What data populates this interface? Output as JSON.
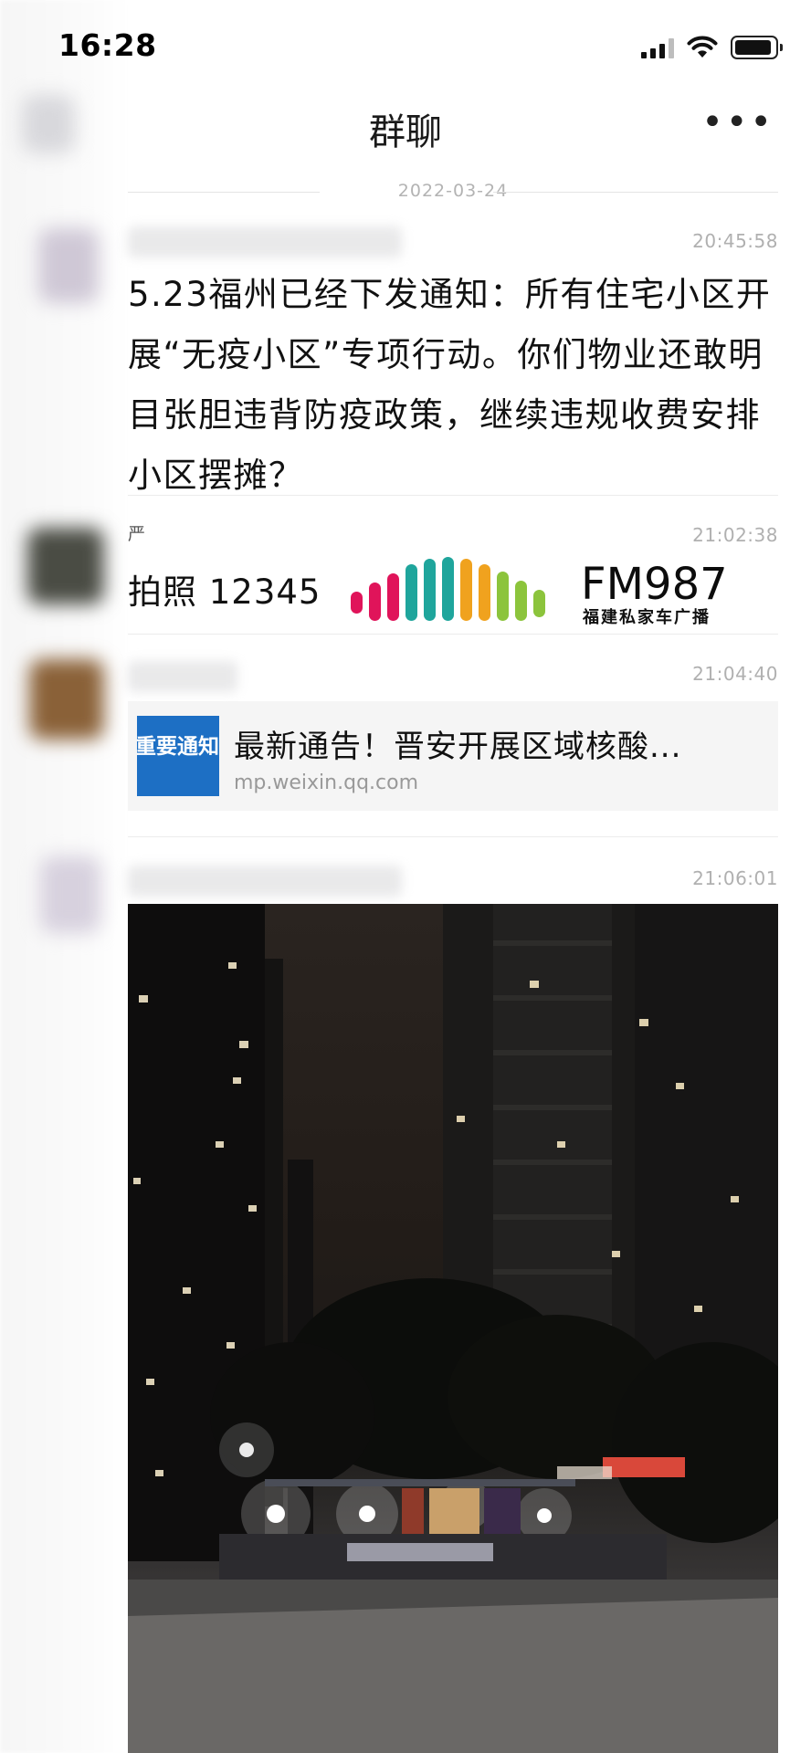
{
  "status_bar": {
    "time": "16:28"
  },
  "header": {
    "title": "群聊",
    "more_label": "•••"
  },
  "date_divider": "2022-03-24",
  "messages": [
    {
      "time": "20:45:58",
      "text": "5.23福州已经下发通知：所有住宅小区开展“无疫小区”专项行动。你们物业还敢明目张胆违背防疫政策，继续违规收费安排小区摆摊？"
    },
    {
      "sender": "严",
      "time": "21:02:38",
      "text": "拍照 12345",
      "logo_text": "FM987",
      "logo_sub": "福建私家车广播"
    },
    {
      "time": "21:04:40",
      "link": {
        "thumb_caption": "重要通知",
        "title": "最新通告！晋安开展区域核酸...",
        "source": "mp.weixin.qq.com"
      }
    },
    {
      "time": "21:06:01",
      "image_desc": "night-street-stalls-photo"
    }
  ],
  "colors": {
    "fm_bar_pink": "#e0145a",
    "fm_bar_teal": "#1fa59c",
    "fm_bar_orange": "#f0a21e",
    "fm_bar_green": "#8cc43c",
    "link_thumb_blue": "#1d6fc4"
  }
}
